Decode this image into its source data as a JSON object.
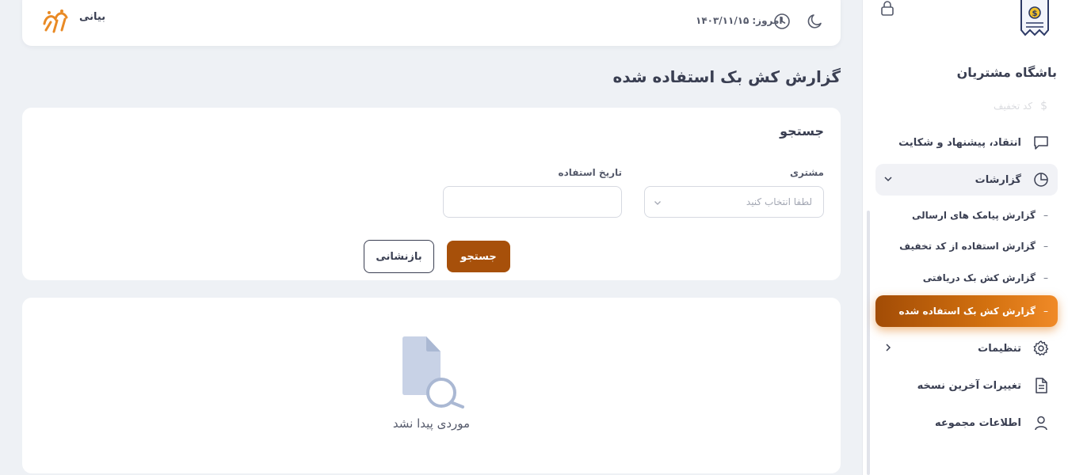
{
  "sidebar": {
    "club_title": "باشگاه مشتریان",
    "faded_item": "کد تخفیف",
    "items": [
      {
        "label": "انتقاد، پیشنهاد و شکایت",
        "icon": "chat-icon"
      },
      {
        "label": "گزارشات",
        "icon": "pie-chart-icon"
      },
      {
        "label": "تنظیمات",
        "icon": "gear-icon"
      },
      {
        "label": "تغییرات آخرین نسخه",
        "icon": "document-icon"
      },
      {
        "label": "اطلاعات مجموعه",
        "icon": "user-icon"
      }
    ],
    "reports_sub": [
      {
        "label": "گزارش پیامک های ارسالی"
      },
      {
        "label": "گزارش استفاده از کد تخفیف"
      },
      {
        "label": "گزارش کش بک دریافتی"
      },
      {
        "label": "گزارش کش بک استفاده شده"
      }
    ],
    "dash": "–"
  },
  "topbar": {
    "username": "بیانی",
    "today_label": "امروز:",
    "today_date": "۱۴۰۳/۱۱/۱۵"
  },
  "page": {
    "title": "گزارش کش بک استفاده شده"
  },
  "search": {
    "heading": "جستجو",
    "customer_label": "مشتری",
    "customer_placeholder": "لطفا انتخاب کنید",
    "date_label": "تاریخ استفاده",
    "date_value": "",
    "search_button": "جستجو",
    "reset_button": "بازنشانی"
  },
  "results": {
    "empty_text": "موردی پیدا نشد"
  },
  "colors": {
    "accent": "#a7500a",
    "active_gradient_start": "#a24c06",
    "active_gradient_end": "#f08a27",
    "background": "#eef1f5"
  }
}
